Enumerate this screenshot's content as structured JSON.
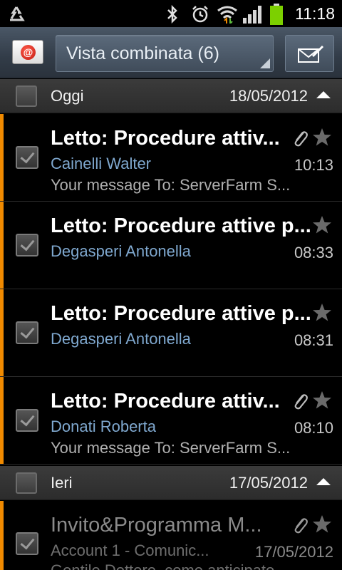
{
  "status_bar": {
    "time": "11:18",
    "icons": [
      "recycle-icon",
      "bluetooth-icon",
      "alarm-icon",
      "wifi-icon",
      "signal-icon",
      "battery-icon"
    ]
  },
  "action_bar": {
    "app_icon": "email-app-icon",
    "view_selector_label": "Vista combinata (6)",
    "compose_icon": "compose-mail-icon"
  },
  "colors": {
    "unread_accent": "#f08a00",
    "sender_blue": "#7fa8cf"
  },
  "sections": [
    {
      "label": "Oggi",
      "date": "18/05/2012",
      "mails": [
        {
          "subject": "Letto: Procedure attiv...",
          "sender": "Cainelli Walter",
          "time": "10:13",
          "preview": "Your message To: ServerFarm S...",
          "attachment": true,
          "unread": true
        },
        {
          "subject": "Letto: Procedure attive p...",
          "sender": "Degasperi Antonella",
          "time": "08:33",
          "preview": "",
          "attachment": false,
          "unread": true
        },
        {
          "subject": "Letto: Procedure attive p...",
          "sender": "Degasperi Antonella",
          "time": "08:31",
          "preview": "",
          "attachment": false,
          "unread": true
        },
        {
          "subject": "Letto: Procedure attiv...",
          "sender": "Donati Roberta",
          "time": "08:10",
          "preview": "Your message To: ServerFarm S...",
          "attachment": true,
          "unread": true
        }
      ]
    },
    {
      "label": "Ieri",
      "date": "17/05/2012",
      "mails": [
        {
          "subject": "Invito&Programma  M...",
          "sender": "Account 1 - Comunic...",
          "time": "17/05/2012",
          "preview": "Gentile Dottore, come anticipato...",
          "attachment": true,
          "unread": false
        }
      ]
    }
  ]
}
